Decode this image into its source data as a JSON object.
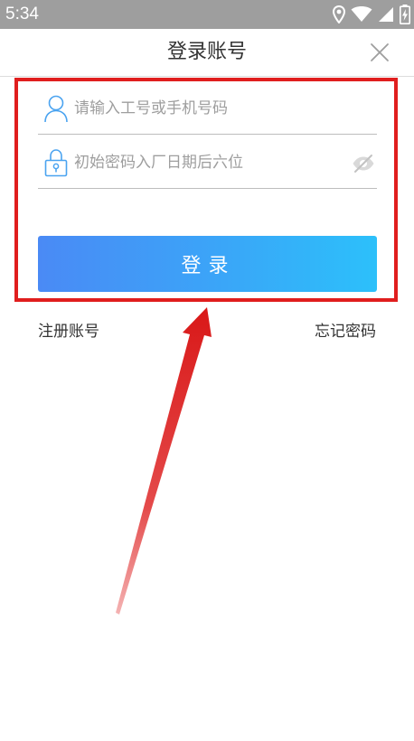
{
  "status_bar": {
    "time": "5:34",
    "icons": [
      "location-icon",
      "wifi-icon",
      "signal-icon",
      "battery-icon"
    ]
  },
  "header": {
    "title": "登录账号",
    "close_icon": "close-icon"
  },
  "form": {
    "username": {
      "placeholder": "请输入工号或手机号码",
      "value": "",
      "icon": "user-icon"
    },
    "password": {
      "placeholder": "初始密码入厂日期后六位",
      "value": "",
      "icon": "lock-icon",
      "toggle_icon": "eye-off-icon"
    },
    "login_label": "登录"
  },
  "links": {
    "register": "注册账号",
    "forgot": "忘记密码"
  },
  "colors": {
    "status_bar": "#9e9e9e",
    "button_start": "#4a8af5",
    "button_end": "#2cc0fa",
    "icon_blue": "#4aa3f0",
    "annotation_red": "#e01e1e"
  }
}
